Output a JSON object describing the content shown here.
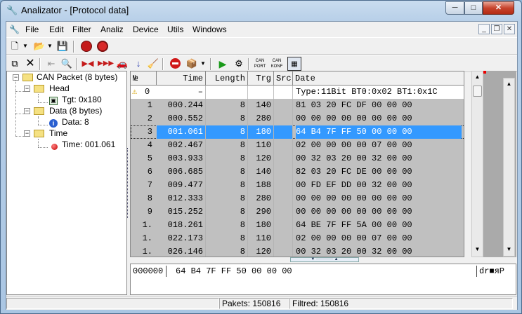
{
  "window": {
    "title": "Analizator - [Protocol data]",
    "min_glyph": "─",
    "max_glyph": "□",
    "close_glyph": "✕"
  },
  "menu": [
    "File",
    "Edit",
    "Filter",
    "Analiz",
    "Device",
    "Utils",
    "Windows"
  ],
  "mdi": {
    "min": "_",
    "restore": "❐",
    "close": "✕"
  },
  "toolbar": {
    "btn_can_port": "CAN PORT",
    "btn_can_konf": "CAN KONF"
  },
  "tree": {
    "root": "CAN Packet (8 bytes)",
    "head": "Head",
    "tgt": "Tgt: 0x180",
    "data": "Data (8 bytes)",
    "data_val": "Data: 8",
    "time": "Time",
    "time_val": "Time: 001.061"
  },
  "grid": {
    "columns": [
      "№",
      "Time",
      "Length",
      "Trg",
      "Src",
      "Date"
    ],
    "info_row": {
      "num": "0",
      "time": "–",
      "date": "Type:11Bit BT0:0x02 BT1:0x1C"
    },
    "rows": [
      {
        "num": "1",
        "time": "000.244",
        "len": "8",
        "trg": "140",
        "data": "81 03 20 FC DF 00 00 00"
      },
      {
        "num": "2",
        "time": "000.552",
        "len": "8",
        "trg": "280",
        "data": "00 00 00 00 00 00 00 00"
      },
      {
        "num": "3",
        "time": "001.061",
        "len": "8",
        "trg": "180",
        "data": "64 B4 7F FF 50 00 00 00"
      },
      {
        "num": "4",
        "time": "002.467",
        "len": "8",
        "trg": "110",
        "data": "02 00 00 00 00 07 00 00"
      },
      {
        "num": "5",
        "time": "003.933",
        "len": "8",
        "trg": "120",
        "data": "00 32 03 20 00 32 00 00"
      },
      {
        "num": "6",
        "time": "006.685",
        "len": "8",
        "trg": "140",
        "data": "82 03 20 FC DE 00 00 00"
      },
      {
        "num": "7",
        "time": "009.477",
        "len": "8",
        "trg": "188",
        "data": "00 FD EF DD 00 32 00 00"
      },
      {
        "num": "8",
        "time": "012.333",
        "len": "8",
        "trg": "280",
        "data": "00 00 00 00 00 00 00 00"
      },
      {
        "num": "9",
        "time": "015.252",
        "len": "8",
        "trg": "290",
        "data": "00 00 00 00 00 00 00 00"
      },
      {
        "num": "1.",
        "time": "018.261",
        "len": "8",
        "trg": "180",
        "data": "64 BE 7F FF 5A 00 00 00"
      },
      {
        "num": "1.",
        "time": "022.173",
        "len": "8",
        "trg": "110",
        "data": "02 00 00 00 00 07 00 00"
      },
      {
        "num": "1.",
        "time": "026.146",
        "len": "8",
        "trg": "120",
        "data": "00 32 03 20 00 32 00 00"
      }
    ]
  },
  "hex": {
    "offset": "000000",
    "bytes": "64  B4  7F  FF  50  00  00  00",
    "ascii": "dr■яР"
  },
  "status": {
    "pakets": "Pakets: 150816",
    "filtred": "Filtred: 150816"
  },
  "colors": {
    "selection": "#3399ff",
    "grid_bg": "#c0c0c0"
  }
}
